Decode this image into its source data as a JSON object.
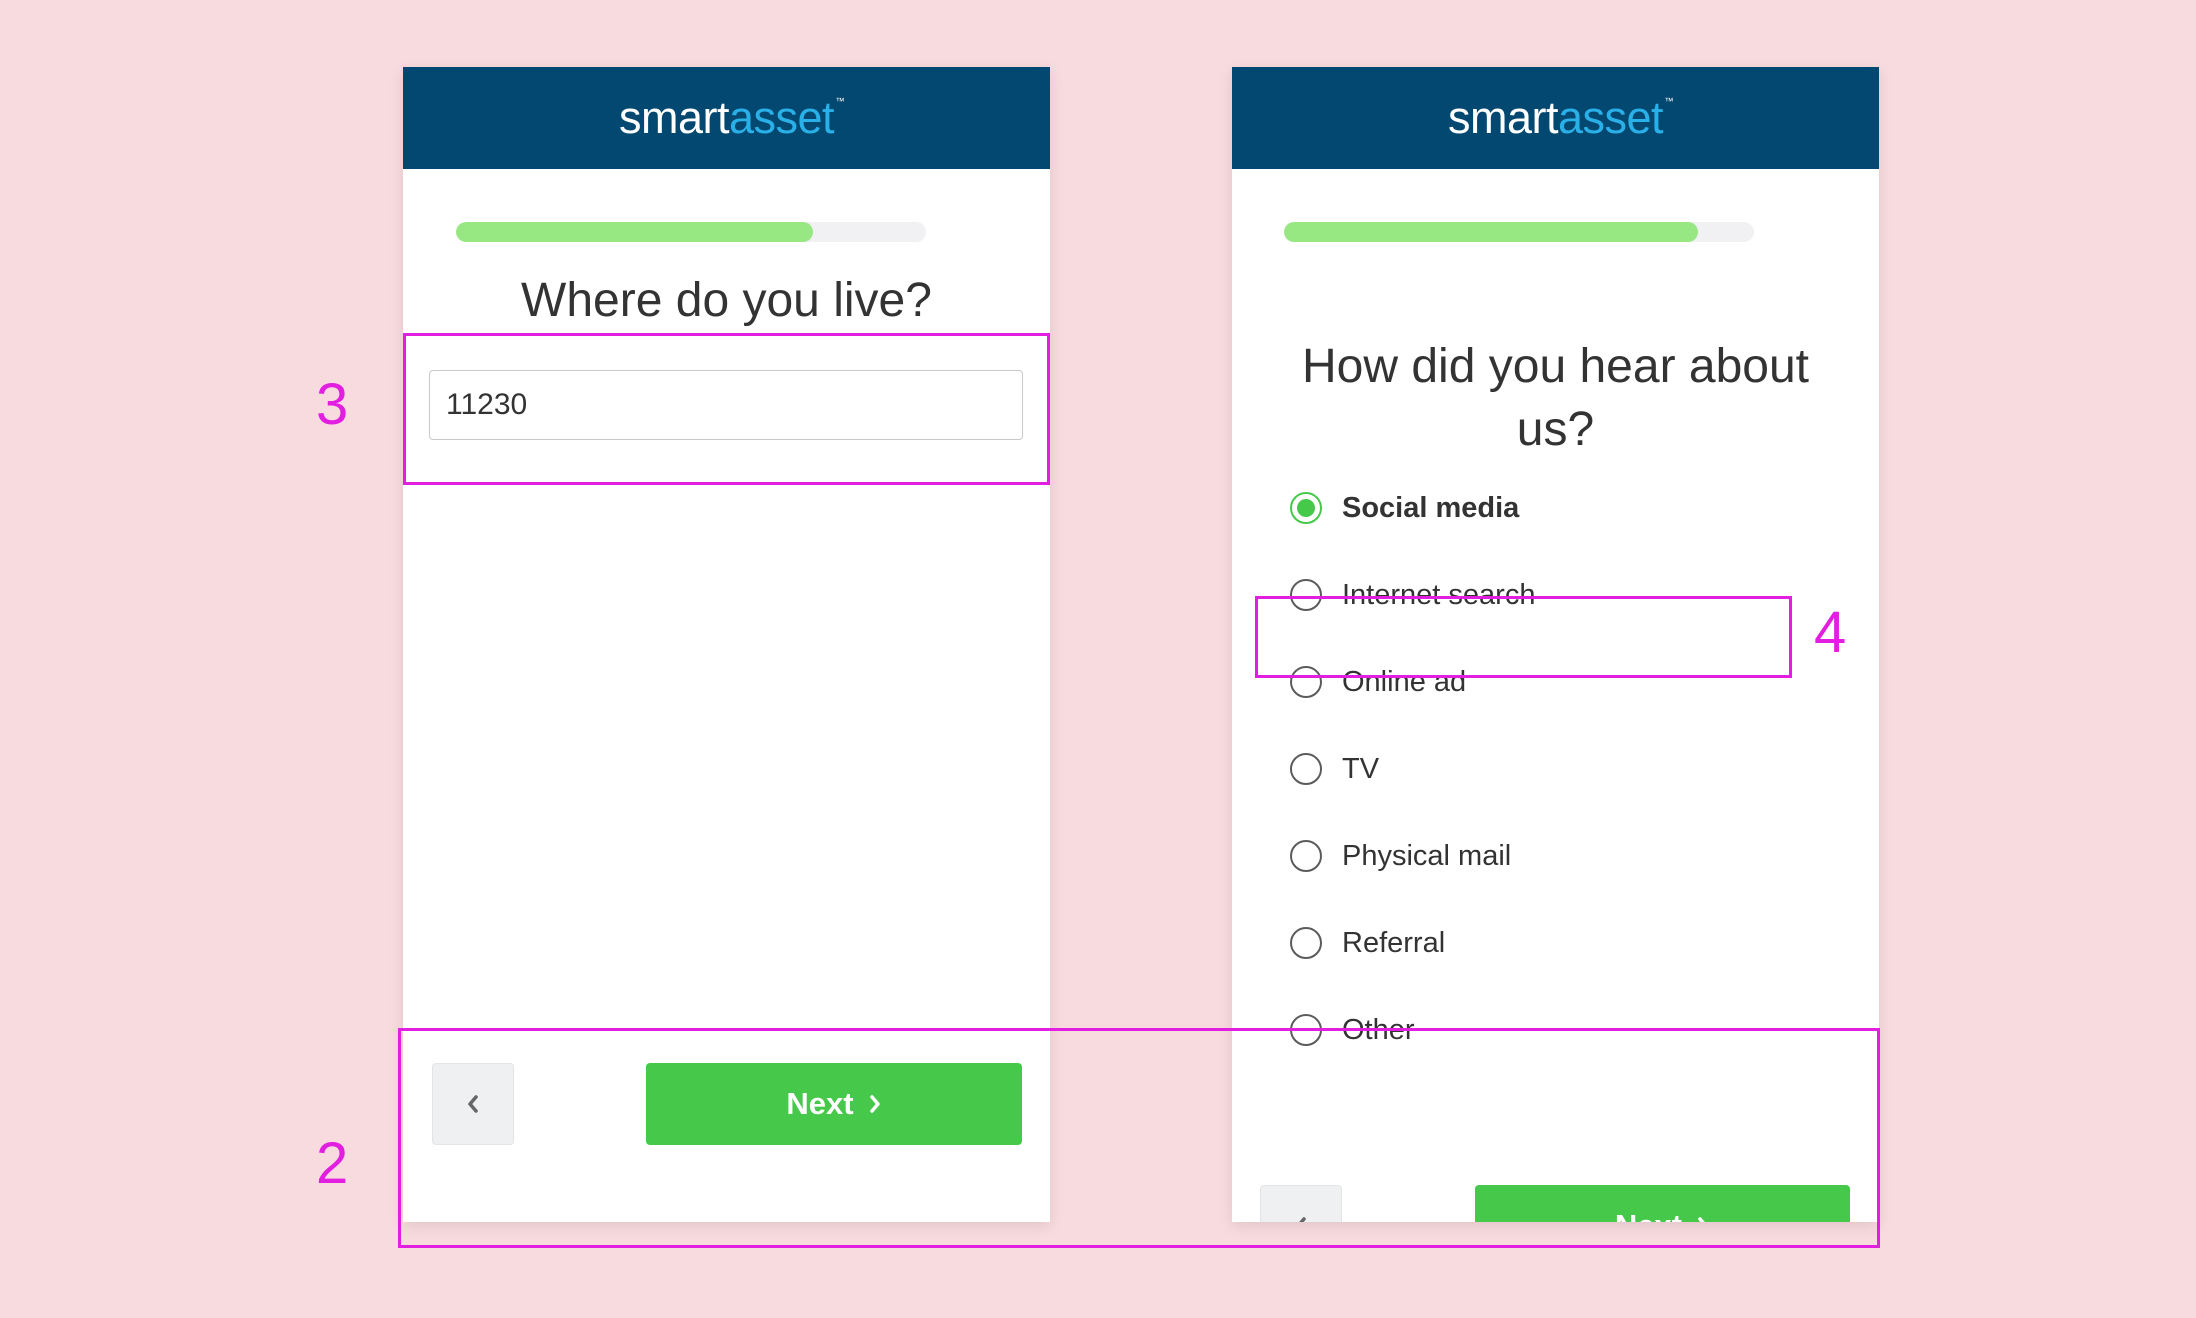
{
  "colors": {
    "background": "#f8dbde",
    "header": "#034870",
    "logo_accent": "#2ab0e8",
    "progress_fill": "#97e882",
    "progress_track": "#f1f1f3",
    "button_green": "#46c94a",
    "highlight": "#e21fe0"
  },
  "left_screen": {
    "logo": {
      "part1": "smart",
      "part2": "asset",
      "tm": "™"
    },
    "progress_fraction": 0.76,
    "question": "Where do you live?",
    "zip_value": "11230",
    "back_icon": "chevron-left-icon",
    "next_label": "Next",
    "next_icon": "chevron-right-icon"
  },
  "right_screen": {
    "logo": {
      "part1": "smart",
      "part2": "asset",
      "tm": "™"
    },
    "progress_fraction": 0.88,
    "question_line1": "How did you hear about",
    "question_line2": "us?",
    "options": [
      {
        "label": "Social media",
        "selected": true
      },
      {
        "label": "Internet search",
        "selected": false
      },
      {
        "label": "Online ad",
        "selected": false
      },
      {
        "label": "TV",
        "selected": false
      },
      {
        "label": "Physical mail",
        "selected": false
      },
      {
        "label": "Referral",
        "selected": false
      },
      {
        "label": "Other",
        "selected": false
      }
    ],
    "next_label": "Next"
  },
  "annotations": {
    "step_2": "2",
    "step_3": "3",
    "step_4": "4"
  }
}
